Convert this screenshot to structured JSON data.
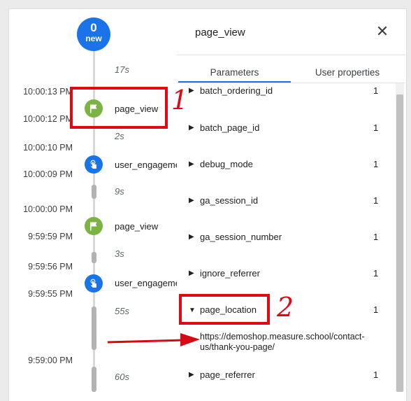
{
  "badge": {
    "count": "0",
    "label": "new"
  },
  "detail": {
    "title": "page_view",
    "tabs": [
      "Parameters",
      "User properties"
    ],
    "params": [
      {
        "name": "batch_ordering_id",
        "count": "1",
        "expanded": false
      },
      {
        "name": "batch_page_id",
        "count": "1",
        "expanded": false
      },
      {
        "name": "debug_mode",
        "count": "1",
        "expanded": false
      },
      {
        "name": "ga_session_id",
        "count": "1",
        "expanded": false
      },
      {
        "name": "ga_session_number",
        "count": "1",
        "expanded": false
      },
      {
        "name": "ignore_referrer",
        "count": "1",
        "expanded": false
      },
      {
        "name": "page_location",
        "count": "1",
        "expanded": true
      },
      {
        "name": "page_referrer",
        "count": "1",
        "expanded": false
      }
    ],
    "page_location_value": "https://demoshop.measure.school/contact-us/thank-you-page/"
  },
  "timeline": {
    "timestamps": [
      "10:00:13 PM",
      "10:00:12 PM",
      "10:00:10 PM",
      "10:00:09 PM",
      "10:00:00 PM",
      "9:59:59 PM",
      "9:59:56 PM",
      "9:59:55 PM",
      "9:59:00 PM"
    ],
    "durations": [
      "17s",
      "2s",
      "9s",
      "3s",
      "55s",
      "60s"
    ],
    "events": [
      {
        "label": "page_view",
        "type": "flag-icon"
      },
      {
        "label": "user_engagement",
        "type": "touch-icon"
      },
      {
        "label": "page_view",
        "type": "flag-icon"
      },
      {
        "label": "user_engagement",
        "type": "touch-icon"
      }
    ]
  },
  "callouts": [
    "1",
    "2"
  ],
  "colors": {
    "accent": "#1a73e8",
    "event_green": "#7cb342",
    "annotation_red": "#e30613"
  }
}
